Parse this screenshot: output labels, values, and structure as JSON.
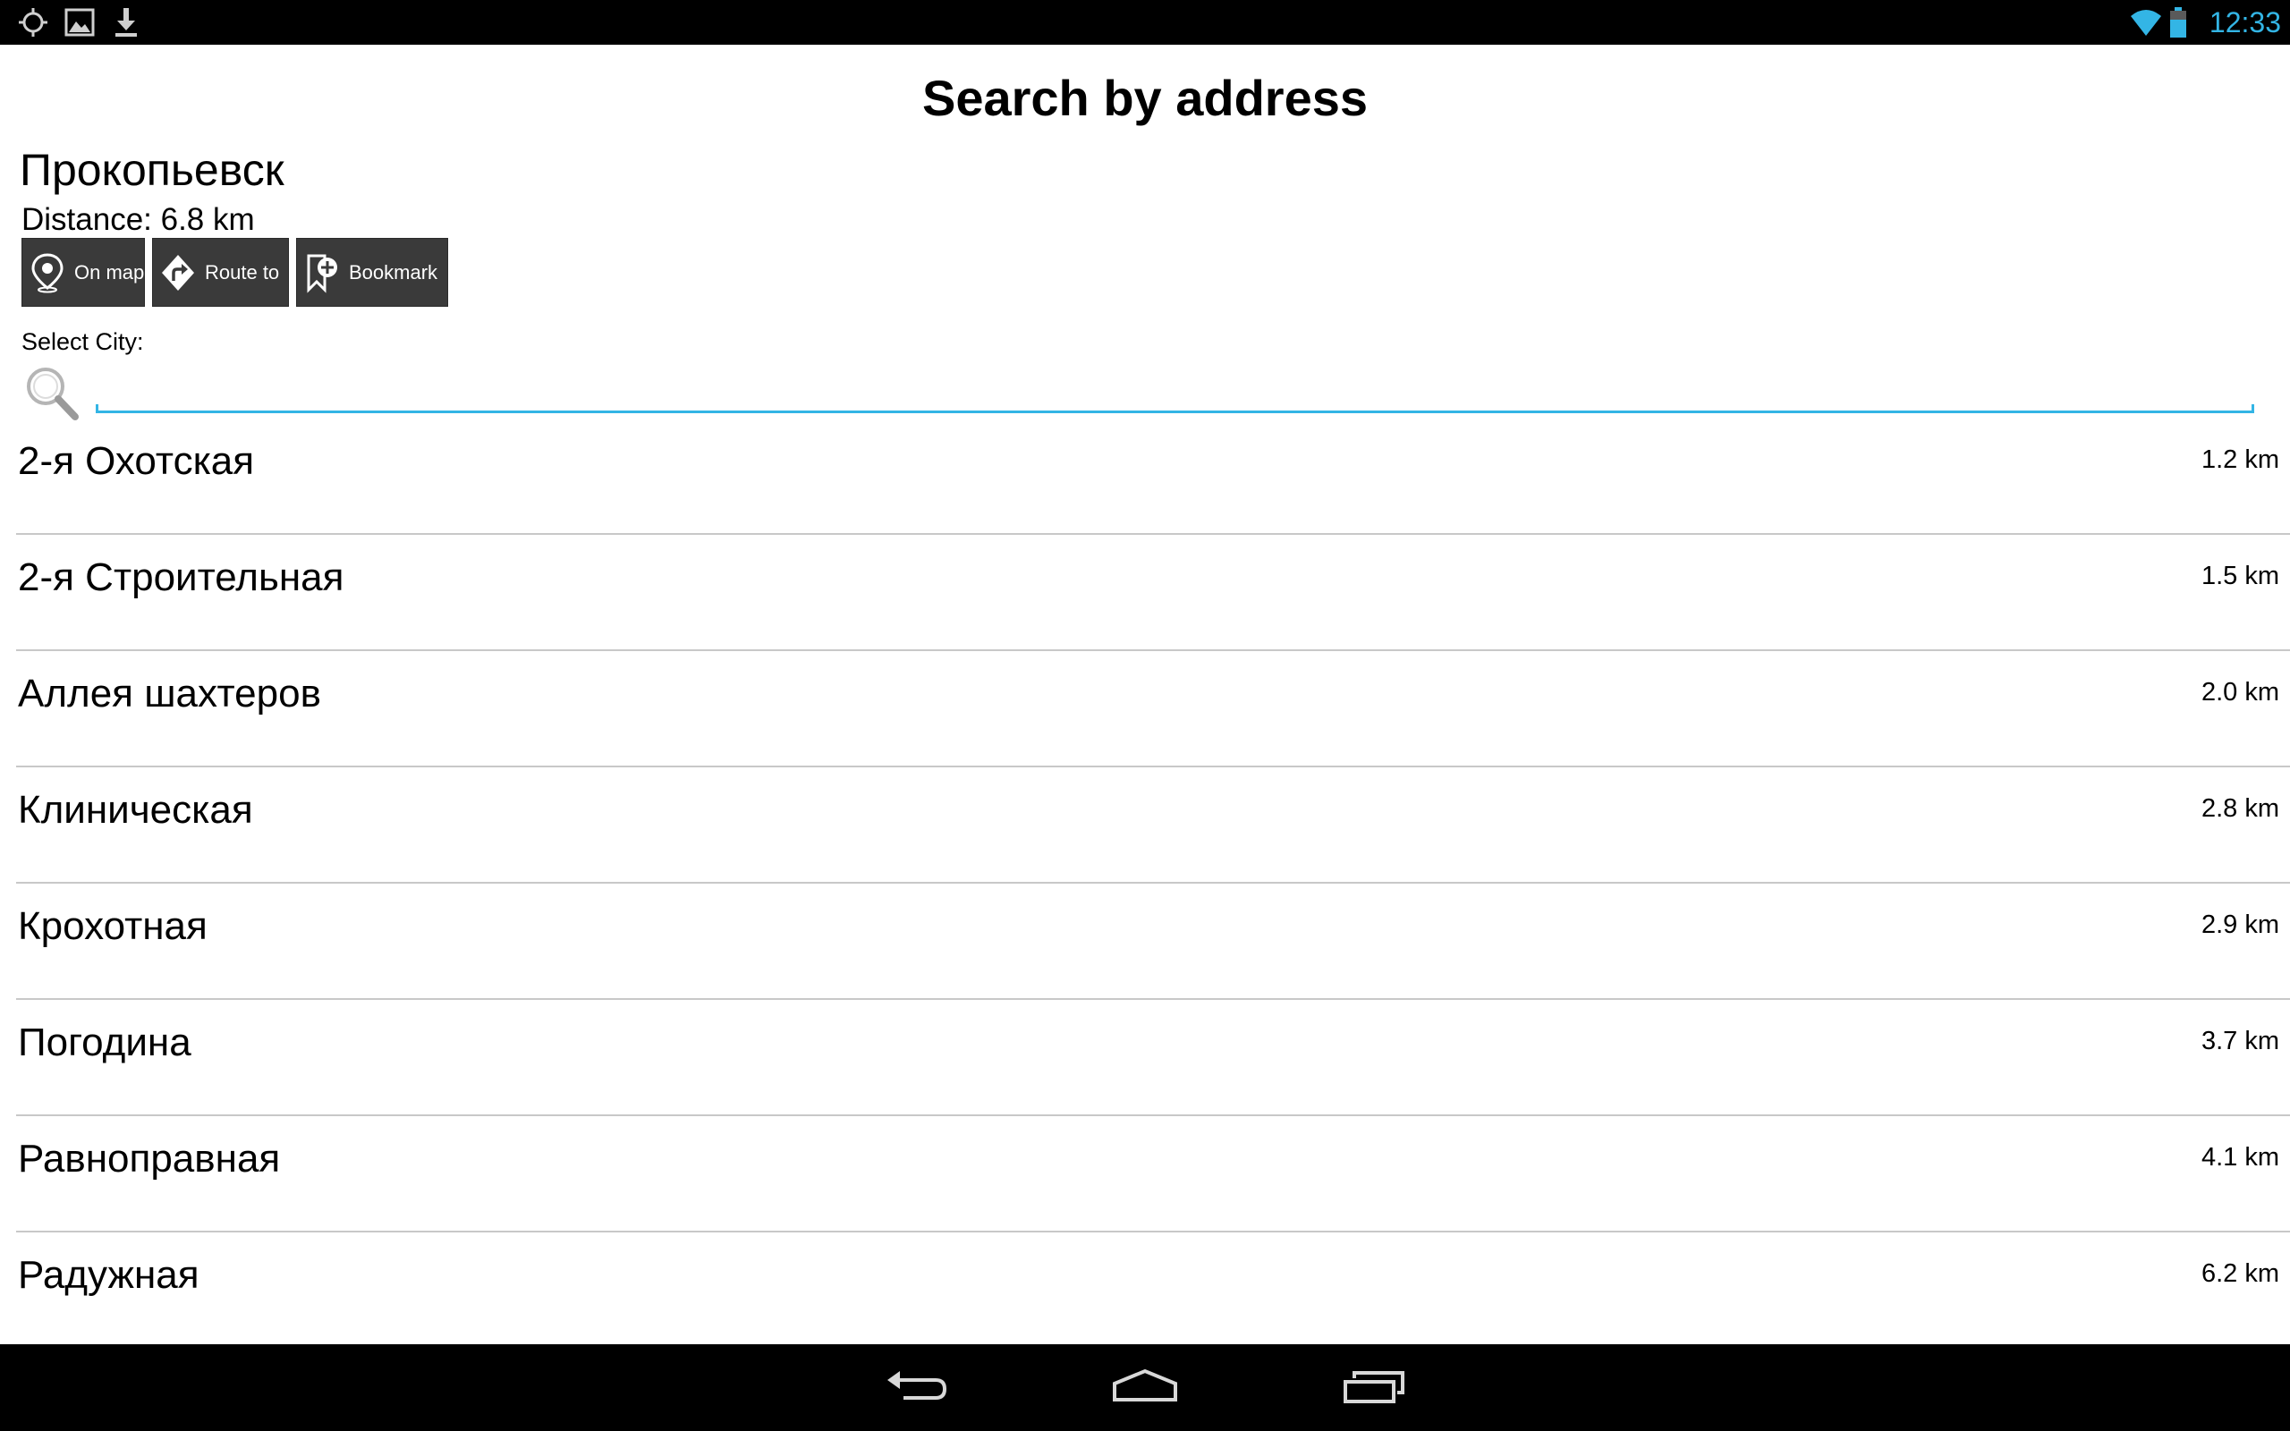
{
  "status_bar": {
    "time": "12:33",
    "left_icons": [
      "gps-icon",
      "gallery-icon",
      "download-icon"
    ],
    "right_icons": [
      "wifi-icon",
      "battery-icon"
    ],
    "accent": "#33b5e5"
  },
  "header": {
    "title": "Search by address"
  },
  "location": {
    "city": "Прокопьевск",
    "distance": "Distance: 6.8 km"
  },
  "actions": {
    "on_map": "On map",
    "route_to": "Route to",
    "bookmark": "Bookmark"
  },
  "search": {
    "label": "Select City:",
    "value": "",
    "placeholder": ""
  },
  "streets": [
    {
      "name": "2-я Охотская",
      "distance": "1.2 km"
    },
    {
      "name": "2-я Строительная",
      "distance": "1.5 km"
    },
    {
      "name": "Аллея шахтеров",
      "distance": "2.0 km"
    },
    {
      "name": "Клиническая",
      "distance": "2.8 km"
    },
    {
      "name": "Крохотная",
      "distance": "2.9 km"
    },
    {
      "name": "Погодина",
      "distance": "3.7 km"
    },
    {
      "name": "Равноправная",
      "distance": "4.1 km"
    },
    {
      "name": "Радужная",
      "distance": "6.2 km"
    }
  ],
  "colors": {
    "button_bg": "#3a3a3a",
    "divider": "#c8c8c8",
    "bars": "#000000"
  }
}
